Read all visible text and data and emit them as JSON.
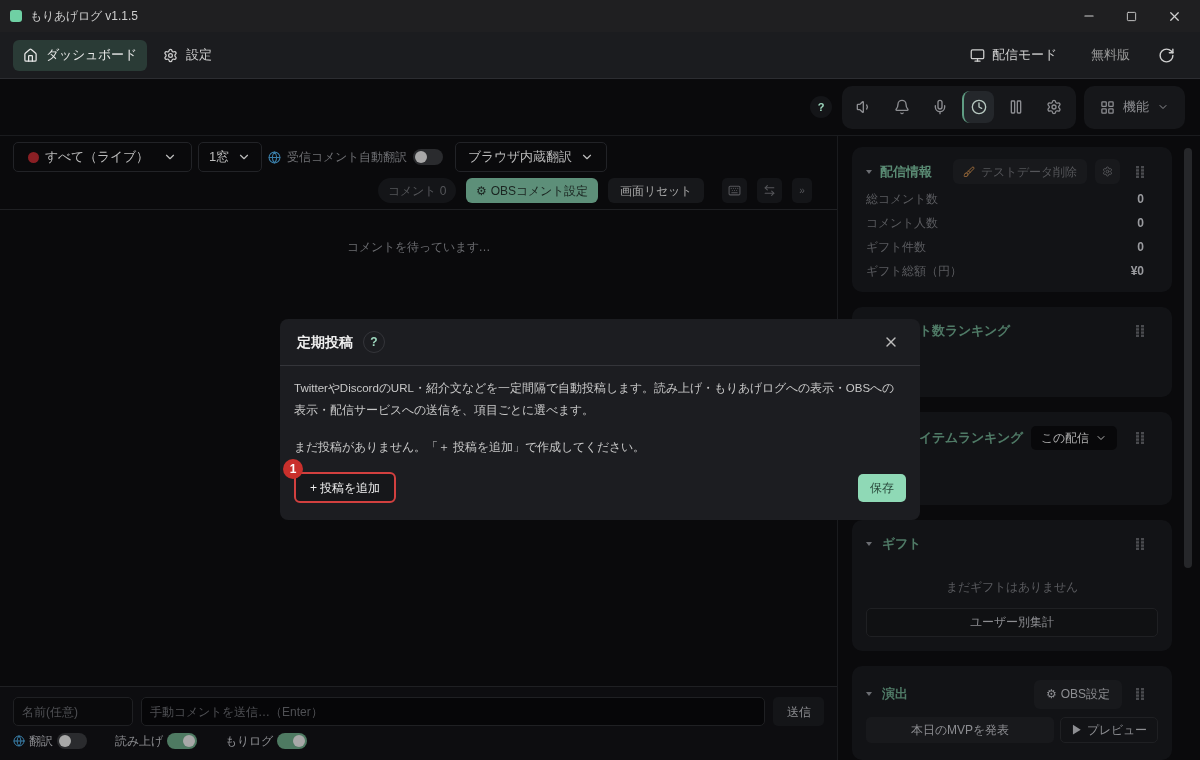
{
  "window": {
    "title": "もりあげログ v1.1.5"
  },
  "nav": {
    "tabs": [
      {
        "label": "ダッシュボード",
        "selected": true,
        "kind": "home"
      },
      {
        "label": "設定",
        "selected": false,
        "kind": "gear"
      }
    ],
    "stream_mode": "配信モード",
    "plan": "無料版"
  },
  "toolbar": {
    "help": "?",
    "tools": [
      {
        "kind": "speaker",
        "selected": false
      },
      {
        "kind": "bell",
        "selected": false
      },
      {
        "kind": "mic",
        "selected": false
      },
      {
        "kind": "clock",
        "selected": true
      },
      {
        "kind": "pause",
        "selected": false
      },
      {
        "kind": "gear",
        "selected": false
      }
    ],
    "features": "機能"
  },
  "filters": {
    "source": "すべて（ライブ）",
    "windows": "1窓",
    "auto_translate": {
      "label": "受信コメント自動翻訳",
      "on": false
    },
    "translator": "ブラウザ内蔵翻訳"
  },
  "actions": {
    "comment_count": "コメント 0",
    "obs_settings": "⚙ OBSコメント設定",
    "reset": "画面リセット",
    "more": "»"
  },
  "empty_message": "コメントを待っています…",
  "composer": {
    "name_placeholder": "名前(任意)",
    "comment_placeholder": "手動コメントを送信…（Enter）",
    "send": "送信",
    "toggles": [
      {
        "label": "翻訳",
        "on": false,
        "kind": "globe"
      },
      {
        "label": "読み上げ",
        "on": true,
        "kind": "plain"
      },
      {
        "label": "もりログ",
        "on": true,
        "kind": "plain"
      }
    ]
  },
  "stats_panel": {
    "title": "配信情報",
    "clear_button": "テストデータ削除",
    "rows": [
      {
        "label": "総コメント数",
        "value": "0"
      },
      {
        "label": "コメント人数",
        "value": "0"
      },
      {
        "label": "ギフト件数",
        "value": "0"
      },
      {
        "label": "ギフト総額（円）",
        "value": "¥0"
      }
    ]
  },
  "comment_ranking": {
    "title": "ト数ランキング"
  },
  "item_ranking": {
    "title": "イテムランキング",
    "scope": "この配信"
  },
  "gift_panel": {
    "title": "ギフト",
    "empty": "まだギフトはありません",
    "by_user": "ユーザー別集計"
  },
  "effects_panel": {
    "title": "演出",
    "obs_settings": "⚙ OBS設定",
    "mvp": "本日のMVPを発表",
    "preview": "▶ プレビュー"
  },
  "dialog": {
    "title": "定期投稿",
    "help": "?",
    "description": "TwitterやDiscordのURL・紹介文などを一定間隔で自動投稿します。読み上げ・もりあげログへの表示・OBSへの表示・配信サービスへの送信を、項目ごとに選べます。",
    "empty": "まだ投稿がありません。「＋ 投稿を追加」で作成してください。",
    "add": "+ 投稿を追加",
    "save": "保存",
    "annotation": "1"
  }
}
